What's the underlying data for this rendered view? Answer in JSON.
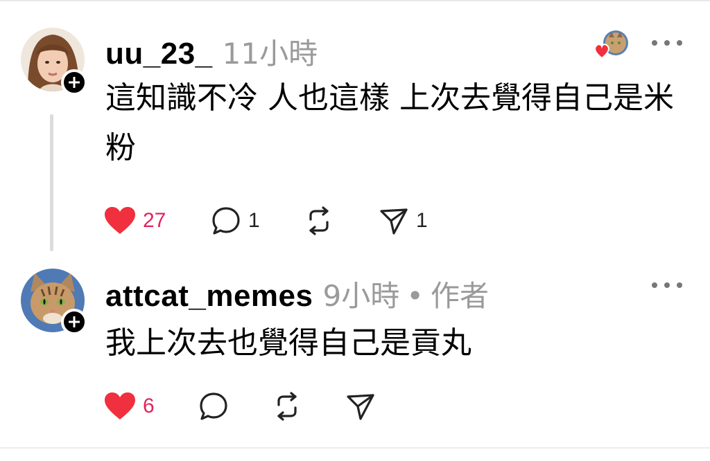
{
  "comments": [
    {
      "username": "uu_23_",
      "time": "11小時",
      "author_tag": "",
      "text": "這知識不冷 人也這樣 上次去覺得自己是米粉",
      "likes": "27",
      "replies": "1",
      "reposts": "",
      "shares": "1",
      "liked": true
    },
    {
      "username": "attcat_memes",
      "time": "9小時",
      "author_tag": "作者",
      "separator": "•",
      "text": "我上次去也覺得自己是貢丸",
      "likes": "6",
      "replies": "",
      "reposts": "",
      "shares": "",
      "liked": true
    }
  ],
  "colors": {
    "like_red": "#f0303e",
    "count_red": "#e0245e",
    "meta_gray": "#9a9a9a",
    "thread_line": "#dcdcdc"
  },
  "icons": [
    "plus-icon",
    "heart-icon",
    "comment-icon",
    "repost-icon",
    "share-icon",
    "more-icon"
  ]
}
